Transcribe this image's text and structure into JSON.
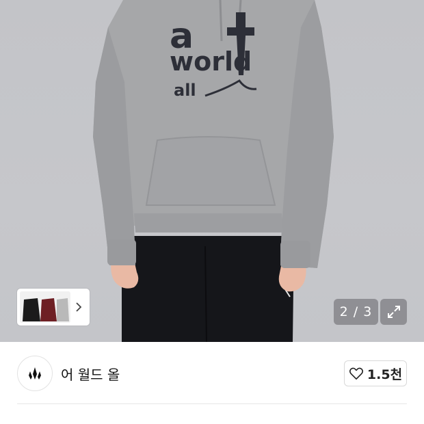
{
  "gallery": {
    "current": "2",
    "separator": "/",
    "total": "3",
    "counter_text": "2 / 3",
    "print_top": "a",
    "print_word": "world",
    "print_bottom": "all",
    "thumbnail_colors": [
      "#1b1b1b",
      "#6e1f24",
      "#b9b9b9"
    ]
  },
  "brand": {
    "name": "어 월드 올",
    "logo_icon": "flame-crown-icon"
  },
  "like": {
    "icon": "heart-outline-icon",
    "count": "1.5천"
  },
  "icons": {
    "thumb_next": "chevron-right-icon",
    "expand": "expand-arrows-icon"
  }
}
